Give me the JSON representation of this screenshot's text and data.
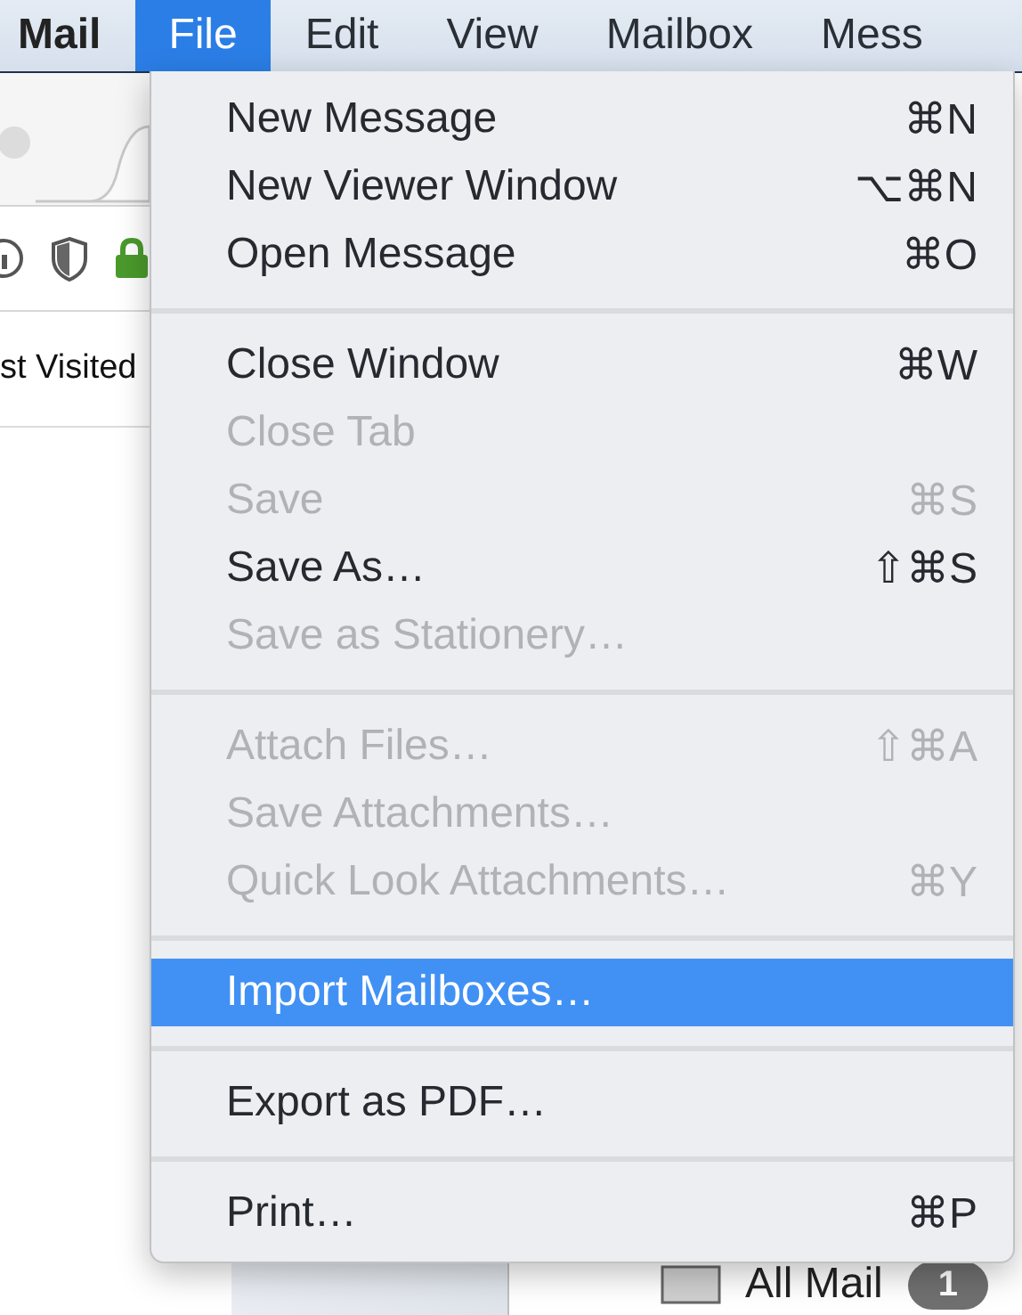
{
  "menubar": {
    "app": "Mail",
    "menus": [
      {
        "label": "File",
        "selected": true
      },
      {
        "label": "Edit",
        "selected": false
      },
      {
        "label": "View",
        "selected": false
      },
      {
        "label": "Mailbox",
        "selected": false
      },
      {
        "label": "Mess",
        "selected": false
      }
    ]
  },
  "browser": {
    "bookmark": "st Visited"
  },
  "file_menu": {
    "items": [
      {
        "kind": "item",
        "label": "New Message",
        "shortcut": "⌘N",
        "disabled": false,
        "selected": false
      },
      {
        "kind": "item",
        "label": "New Viewer Window",
        "shortcut": "⌥⌘N",
        "disabled": false,
        "selected": false
      },
      {
        "kind": "item",
        "label": "Open Message",
        "shortcut": "⌘O",
        "disabled": false,
        "selected": false
      },
      {
        "kind": "separator"
      },
      {
        "kind": "item",
        "label": "Close Window",
        "shortcut": "⌘W",
        "disabled": false,
        "selected": false
      },
      {
        "kind": "item",
        "label": "Close Tab",
        "disabled": true,
        "selected": false
      },
      {
        "kind": "item",
        "label": "Save",
        "shortcut": "⌘S",
        "disabled": true,
        "selected": false
      },
      {
        "kind": "item",
        "label": "Save As…",
        "shortcut": "⇧⌘S",
        "disabled": false,
        "selected": false
      },
      {
        "kind": "item",
        "label": "Save as Stationery…",
        "disabled": true,
        "selected": false
      },
      {
        "kind": "separator"
      },
      {
        "kind": "item",
        "label": "Attach Files…",
        "shortcut": "⇧⌘A",
        "disabled": true,
        "selected": false
      },
      {
        "kind": "item",
        "label": "Save Attachments…",
        "disabled": true,
        "selected": false
      },
      {
        "kind": "item",
        "label": "Quick Look Attachments…",
        "shortcut": "⌘Y",
        "disabled": true,
        "selected": false
      },
      {
        "kind": "separator"
      },
      {
        "kind": "item",
        "label": "Import Mailboxes…",
        "disabled": false,
        "selected": true
      },
      {
        "kind": "separator"
      },
      {
        "kind": "item",
        "label": "Export as PDF…",
        "disabled": false,
        "selected": false
      },
      {
        "kind": "separator"
      },
      {
        "kind": "item",
        "label": "Print…",
        "shortcut": "⌘P",
        "disabled": false,
        "selected": false
      }
    ]
  },
  "mailbox": {
    "label": "All Mail",
    "badge": "1"
  }
}
